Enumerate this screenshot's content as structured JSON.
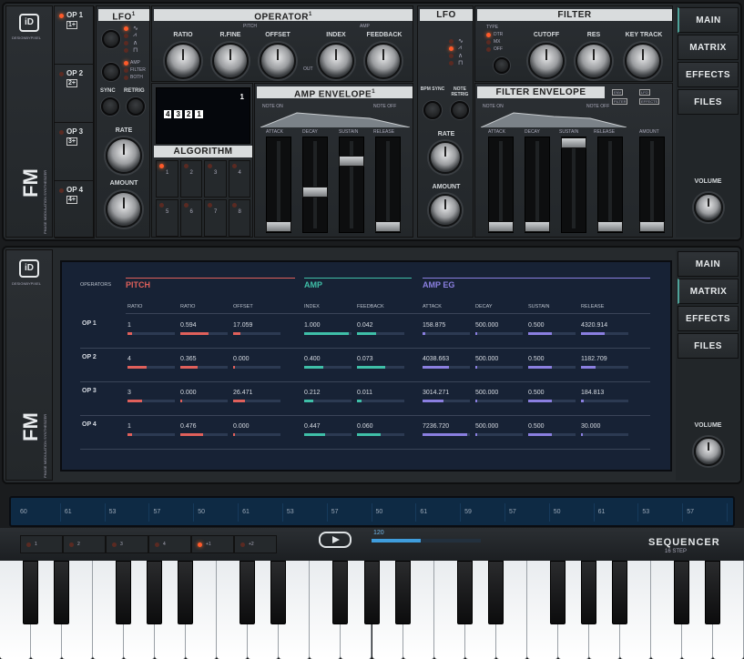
{
  "upper": {
    "ops": [
      "OP 1",
      "OP 2",
      "OP 3",
      "OP 4"
    ],
    "op_badges": [
      "1+",
      "2+",
      "3+",
      "4+"
    ],
    "lfo1": {
      "title": "LFO",
      "sup": "1",
      "amp": "AMP",
      "filter": "FILTER",
      "both": "BOTH",
      "sync": "SYNC",
      "retrig": "RETRIG",
      "rate": "RATE",
      "amount": "AMOUNT"
    },
    "operator": {
      "title": "OPERATOR",
      "sup": "1",
      "pitch": "PITCH",
      "amp": "AMP",
      "ratio": "RATIO",
      "rfine": "R.FINE",
      "offset": "OFFSET",
      "index": "INDEX",
      "feedback": "FEEDBACK",
      "out": "OUT"
    },
    "algo": {
      "title": "ALGORITHM",
      "display_num": "1",
      "chain": [
        "4",
        "3",
        "2",
        "1"
      ],
      "nums": [
        "1",
        "2",
        "3",
        "4",
        "5",
        "6",
        "7",
        "8"
      ]
    },
    "amp_env": {
      "title": "AMP ENVELOPE",
      "sup": "1",
      "note_on": "NOTE ON",
      "note_off": "NOTE OFF",
      "stages": [
        "ATTACK",
        "DECAY",
        "SUSTAIN",
        "RELEASE"
      ]
    },
    "lfo2": {
      "title": "LFO",
      "type": "TYPE",
      "types": [
        "DTR",
        "MX",
        "OFF"
      ],
      "bpm_sync": "BPM SYNC",
      "note_retrig": "NOTE RETRIG",
      "rate": "RATE",
      "amount": "AMOUNT"
    },
    "filter": {
      "title": "FILTER",
      "cutoff": "CUTOFF",
      "res": "RES",
      "keytrack": "KEY TRACK"
    },
    "filter_env": {
      "title": "FILTER ENVELOPE",
      "note_on": "NOTE ON",
      "note_off": "NOTE OFF",
      "stages": [
        "ATTACK",
        "DECAY",
        "SUSTAIN",
        "RELEASE",
        "AMOUNT"
      ],
      "badges": [
        "ENV",
        "FILTER",
        "LFO",
        "EFFECTS"
      ]
    },
    "side": {
      "tabs": [
        "MAIN",
        "MATRIX",
        "EFFECTS",
        "FILES"
      ],
      "volume": "VOLUME"
    },
    "brand": {
      "fm": "FM",
      "sub": "PHASE MODULATION SYNTHESIZER",
      "logo": "DesignByPixel"
    }
  },
  "lower": {
    "side": {
      "tabs": [
        "MAIN",
        "MATRIX",
        "EFFECTS",
        "FILES"
      ],
      "volume": "VOLUME"
    },
    "brand": {
      "fm": "FM",
      "sub": "PHASE MODULATION SYNTHESIZER",
      "logo": "DesignByPixel"
    },
    "matrix": {
      "operators": "OPERATORS",
      "groups": {
        "pitch": "PITCH",
        "amp": "AMP",
        "ampeg": "AMP EG"
      },
      "cols": {
        "ratio1": "RATIO",
        "ratio2": "RATIO",
        "offset": "OFFSET",
        "index": "INDEX",
        "feedback": "FEEDBACK",
        "attack": "ATTACK",
        "decay": "DECAY",
        "sustain": "SUSTAIN",
        "release": "RELEASE"
      },
      "rows": [
        {
          "op": "OP 1",
          "ratio": "1",
          "rfine": "0.594",
          "offset": "17.059",
          "index": "1.000",
          "feedback": "0.042",
          "attack": "158.875",
          "decay": "500.000",
          "sustain": "0.500",
          "release": "4320.914"
        },
        {
          "op": "OP 2",
          "ratio": "4",
          "rfine": "0.365",
          "offset": "0.000",
          "index": "0.400",
          "feedback": "0.073",
          "attack": "4038.663",
          "decay": "500.000",
          "sustain": "0.500",
          "release": "1182.709"
        },
        {
          "op": "OP 3",
          "ratio": "3",
          "rfine": "0.000",
          "offset": "26.471",
          "index": "0.212",
          "feedback": "0.011",
          "attack": "3014.271",
          "decay": "500.000",
          "sustain": "0.500",
          "release": "184.813"
        },
        {
          "op": "OP 4",
          "ratio": "1",
          "rfine": "0.476",
          "offset": "0.000",
          "index": "0.447",
          "feedback": "0.060",
          "attack": "7236.720",
          "decay": "500.000",
          "sustain": "0.500",
          "release": "30.000"
        }
      ],
      "fills": [
        [
          0.1,
          0.6,
          0.15,
          0.95,
          0.4,
          0.05,
          0.01,
          0.5,
          0.5
        ],
        [
          0.4,
          0.37,
          0.0,
          0.4,
          0.6,
          0.55,
          0.01,
          0.5,
          0.3
        ],
        [
          0.3,
          0.0,
          0.25,
          0.2,
          0.1,
          0.45,
          0.01,
          0.5,
          0.05
        ],
        [
          0.1,
          0.48,
          0.0,
          0.45,
          0.5,
          0.95,
          0.01,
          0.5,
          0.02
        ]
      ]
    }
  },
  "sequencer": {
    "steps": [
      "60",
      "61",
      "53",
      "57",
      "50",
      "61",
      "53",
      "57",
      "50",
      "61",
      "59",
      "57",
      "50",
      "61",
      "53",
      "57"
    ],
    "tempo": "120",
    "tempo_fill": 0.45,
    "pattern_buttons": [
      "1",
      "2",
      "3",
      "4",
      "+1",
      "+2"
    ],
    "title": "SEQUENCER",
    "subtitle": "16 STEP"
  },
  "colors": {
    "pitch": "#e0605b",
    "amp": "#3fbfa8",
    "ampeg": "#8a7fe0",
    "accent": "#ff5a2a"
  }
}
